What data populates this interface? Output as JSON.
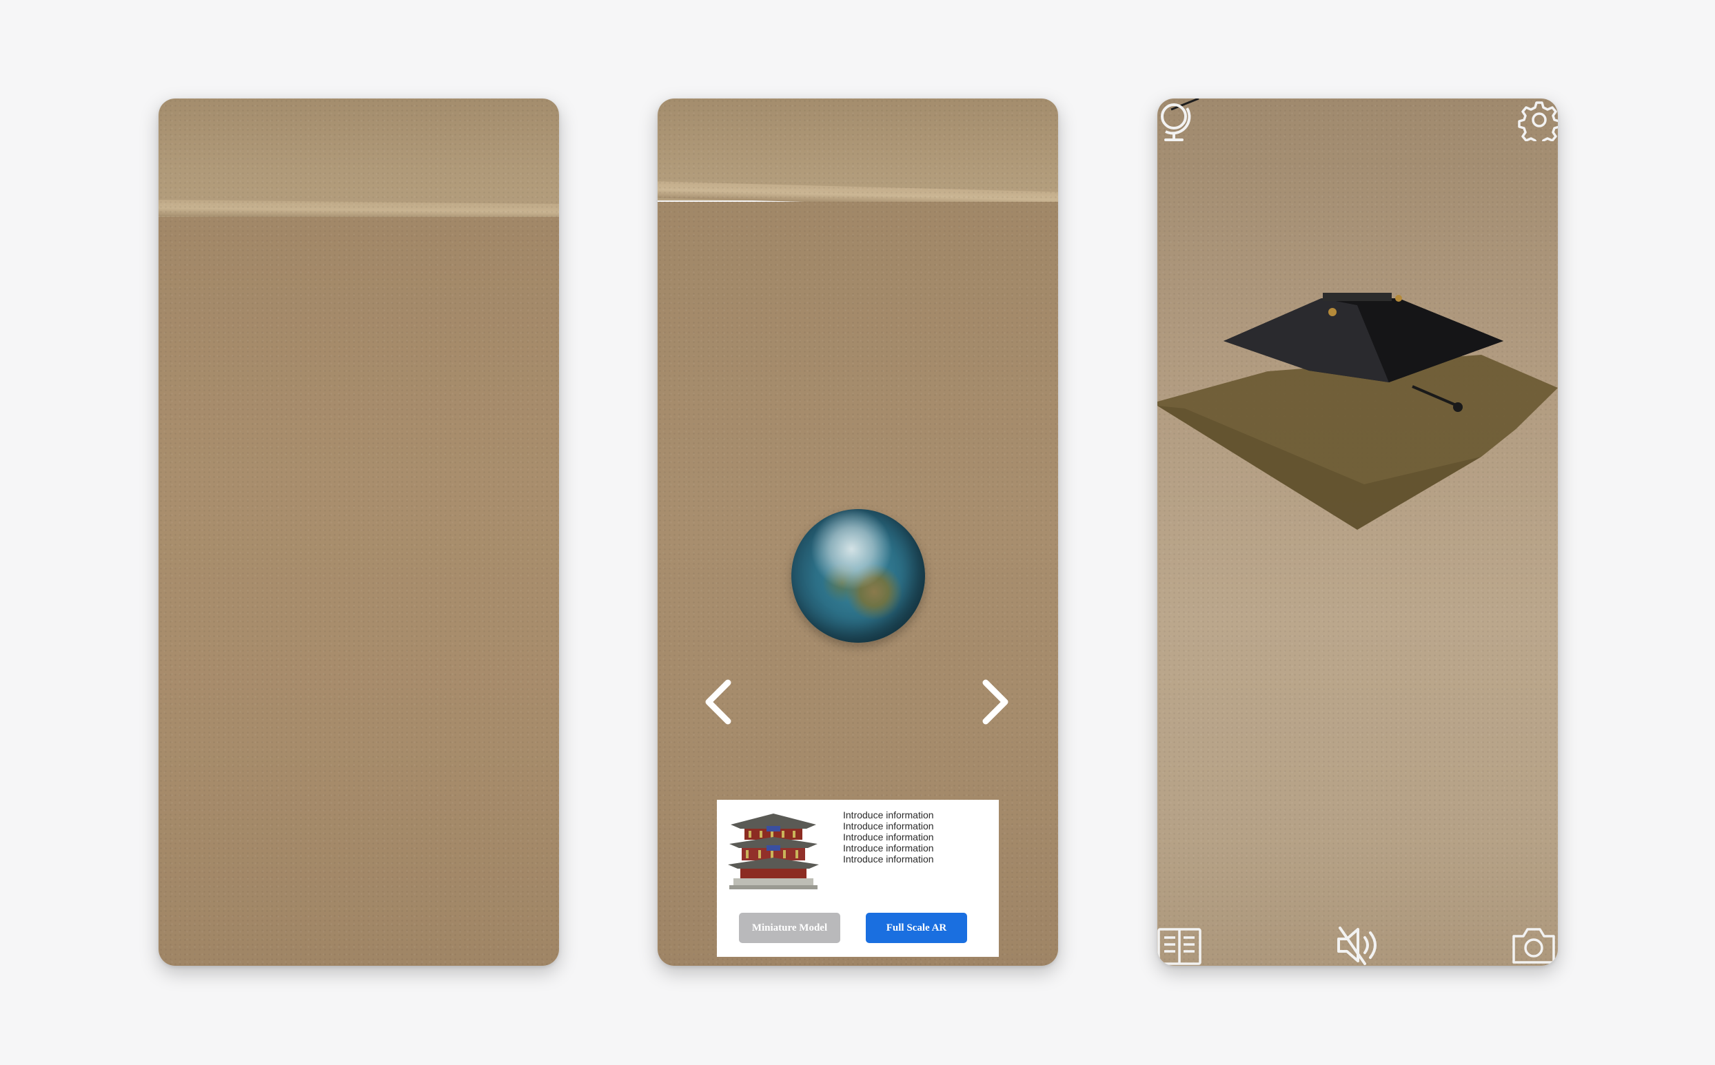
{
  "screens": [
    {
      "id": "camera-scan",
      "scene": "carpet-floor-with-wall"
    },
    {
      "id": "model-selector",
      "scene": "carpet-floor-with-wall",
      "model_preview": "globe",
      "nav": {
        "prev_icon": "chevron-left-icon",
        "next_icon": "chevron-right-icon"
      },
      "info_card": {
        "thumbnail": "pagoda-thumbnail",
        "lines": [
          "Introduce information",
          "Introduce information",
          "Introduce information",
          "Introduce information",
          "Introduce information"
        ],
        "miniature_label": "Miniature Model",
        "fullscale_label": "Full Scale AR"
      }
    },
    {
      "id": "ar-placement",
      "scene": "carpet-floor",
      "placed_model": "pagoda-roof",
      "icons": {
        "top_left": "globe-stand-icon",
        "top_right": "settings-icon",
        "bottom_left": "catalog-icon",
        "bottom_center": "mute-icon",
        "bottom_right": "camera-icon"
      }
    }
  ],
  "colors": {
    "page_background": "#f6f6f7",
    "carpet": "#a88e6e",
    "primary_button": "#1a6fe0",
    "secondary_button": "#b9b9bb",
    "overlay_icon": "#f2f2f2"
  }
}
